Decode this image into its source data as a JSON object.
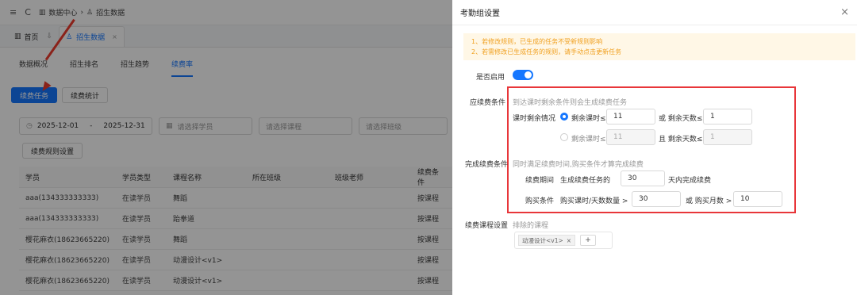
{
  "app": {
    "menu_icon": "≡",
    "refresh_icon": "C",
    "breadcrumb": [
      "数据中心",
      "招生数据"
    ],
    "tabs": {
      "home": "首页",
      "active": "招生数据"
    },
    "subtabs": [
      "数据概况",
      "招生排名",
      "招生趋势",
      "续费率"
    ],
    "buttons": {
      "renewal_task": "续费任务",
      "renewal_stats": "续费统计",
      "rule_settings": "续费规则设置"
    },
    "filters": {
      "date_start": "2025-12-01",
      "date_sep": "-",
      "date_end": "2025-12-31",
      "student_placeholder": "请选择学员",
      "course_placeholder": "请选择课程",
      "class_placeholder": "请选择班级"
    },
    "table": {
      "headers": [
        "学员",
        "学员类型",
        "课程名称",
        "所在班级",
        "班级老师",
        "续费条件"
      ],
      "rows": [
        [
          "aaa(134333333333)",
          "在读学员",
          "舞蹈",
          "",
          "",
          "按课程"
        ],
        [
          "aaa(134333333333)",
          "在读学员",
          "跆拳道",
          "",
          "",
          "按课程"
        ],
        [
          "樱花麻衣(18623665220)",
          "在读学员",
          "舞蹈",
          "",
          "",
          "按课程"
        ],
        [
          "樱花麻衣(18623665220)",
          "在读学员",
          "动漫设计<v1>",
          "",
          "",
          "按课程"
        ],
        [
          "樱花麻衣(18623665220)",
          "在读学员",
          "动漫设计<v1>",
          "",
          "",
          "按课程"
        ]
      ]
    }
  },
  "drawer": {
    "title": "考勤组设置",
    "close_icon": "×",
    "notice": [
      "1、若修改规则，已生成的任务不受新规则影响",
      "2、若需修改已生成任务的规则，请手动点击更新任务"
    ],
    "enabled_label": "是否启用",
    "enabled": true,
    "renewal_condition_label": "应续费条件",
    "renewal_condition_hint": "到达课时剩余条件则会生成续费任务",
    "remaining_label": "课时剩余情况",
    "option1": {
      "label": "剩余课时≤",
      "value": "11",
      "or": "或 剩余天数≤",
      "days": "1"
    },
    "option2": {
      "label": "剩余课时≤",
      "value": "11",
      "and": "且 剩余天数≤",
      "days": "1"
    },
    "complete_label": "完成续费条件",
    "complete_hint": "同时满足续费时间,购买条件才算完成续费",
    "period_label": "续费期间",
    "period_prefix": "生成续费任务的",
    "period_value": "30",
    "period_suffix": "天内完成续费",
    "purchase_label": "购买条件",
    "purchase_prefix": "购买课时/天数数量 >",
    "purchase_value": "30",
    "purchase_or": "或 购买月数 >",
    "purchase_months": "10",
    "course_settings_label": "续费课程设置",
    "excluded_label": "排除的课程",
    "excluded_tag": "动漫设计<v1>",
    "tag_close": "×",
    "add_icon": "+"
  },
  "colors": {
    "accent": "#1677ff",
    "highlight": "#e8363a",
    "notice_text": "#f0a020",
    "notice_bg": "#fff7e6"
  }
}
